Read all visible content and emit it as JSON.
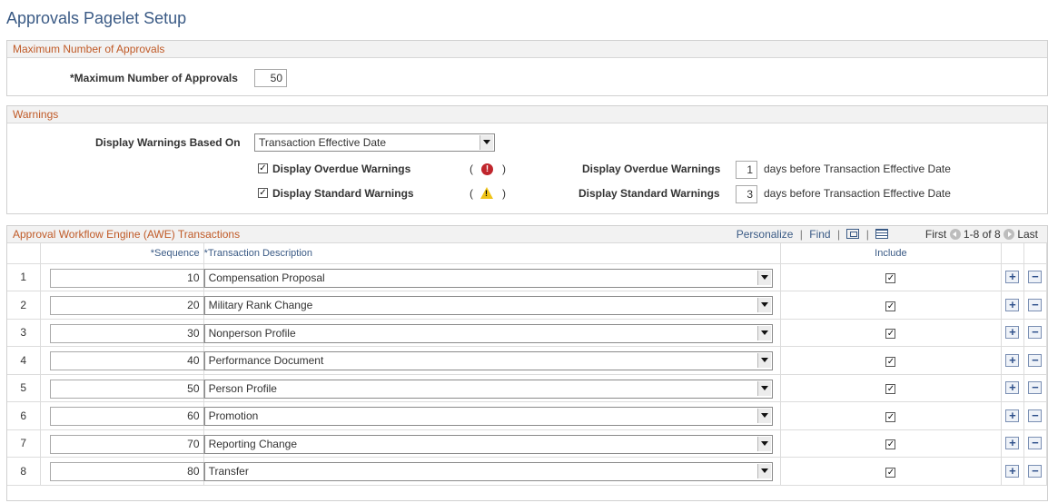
{
  "page": {
    "title": "Approvals Pagelet Setup"
  },
  "max_section": {
    "header": "Maximum Number of Approvals",
    "label": "*Maximum Number of Approvals",
    "value": "50"
  },
  "warnings": {
    "header": "Warnings",
    "based_on_label": "Display Warnings Based On",
    "based_on_value": "Transaction Effective Date",
    "overdue": {
      "checkbox_label": "Display Overdue Warnings",
      "checked": true,
      "days_label": "Display Overdue Warnings",
      "days_value": "1",
      "days_suffix": "days before Transaction Effective Date"
    },
    "standard": {
      "checkbox_label": "Display Standard Warnings",
      "checked": true,
      "days_label": "Display Standard Warnings",
      "days_value": "3",
      "days_suffix": "days before Transaction Effective Date"
    },
    "paren_open": "(",
    "paren_close": ")",
    "error_icon_glyph": "!",
    "warn_icon_glyph": "!"
  },
  "awe": {
    "header": "Approval Workflow Engine (AWE) Transactions",
    "tools": {
      "personalize": "Personalize",
      "sep": "|",
      "find": "Find",
      "first": "First",
      "range": "1-8 of 8",
      "last": "Last"
    },
    "columns": {
      "sequence": "*Sequence",
      "description": "*Transaction Description",
      "include": "Include"
    },
    "check_glyph": "✓",
    "add_glyph": "+",
    "remove_glyph": "−",
    "rows": [
      {
        "num": "1",
        "sequence": "10",
        "description": "Compensation Proposal",
        "include": true
      },
      {
        "num": "2",
        "sequence": "20",
        "description": "Military Rank Change",
        "include": true
      },
      {
        "num": "3",
        "sequence": "30",
        "description": "Nonperson Profile",
        "include": true
      },
      {
        "num": "4",
        "sequence": "40",
        "description": "Performance Document",
        "include": true
      },
      {
        "num": "5",
        "sequence": "50",
        "description": "Person Profile",
        "include": true
      },
      {
        "num": "6",
        "sequence": "60",
        "description": "Promotion",
        "include": true
      },
      {
        "num": "7",
        "sequence": "70",
        "description": "Reporting Change",
        "include": true
      },
      {
        "num": "8",
        "sequence": "80",
        "description": "Transfer",
        "include": true
      }
    ]
  },
  "colors": {
    "title": "#3a5a85",
    "section_header": "#c05a27",
    "error": "#c0262d",
    "warning": "#f0c419"
  }
}
